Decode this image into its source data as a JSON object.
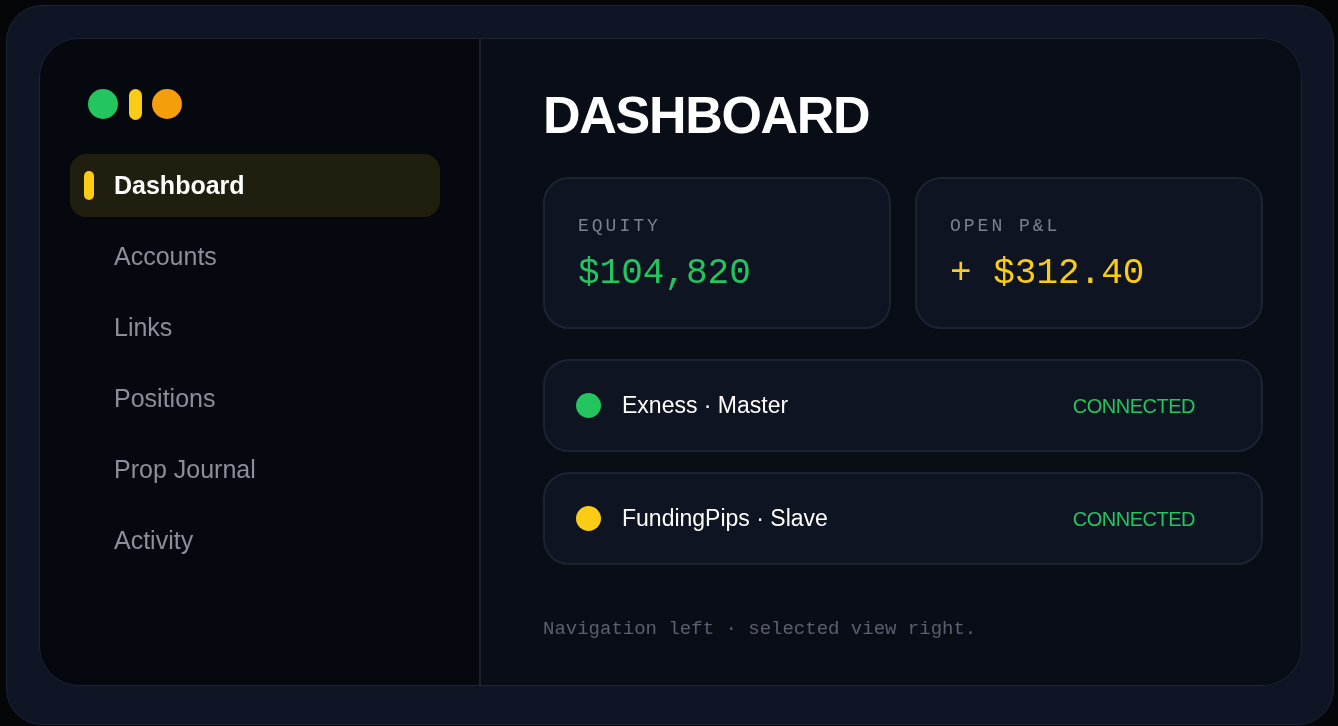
{
  "sidebar": {
    "items": [
      {
        "label": "Dashboard",
        "selected": true
      },
      {
        "label": "Accounts",
        "selected": false
      },
      {
        "label": "Links",
        "selected": false
      },
      {
        "label": "Positions",
        "selected": false
      },
      {
        "label": "Prop Journal",
        "selected": false
      },
      {
        "label": "Activity",
        "selected": false
      }
    ]
  },
  "main": {
    "title": "DASHBOARD",
    "stats": [
      {
        "label": "EQUITY",
        "value": "$104,820",
        "color": "#22c55e"
      },
      {
        "label": "OPEN P&L",
        "value": "+ $312.40",
        "color": "#facc15"
      }
    ],
    "connections": [
      {
        "name": "Exness · Master",
        "color": "#22c55e",
        "status": "CONNECTED"
      },
      {
        "name": "FundingPips · Slave",
        "color": "#facc15",
        "status": "CONNECTED"
      }
    ],
    "footnote": "Navigation left · selected view right."
  }
}
